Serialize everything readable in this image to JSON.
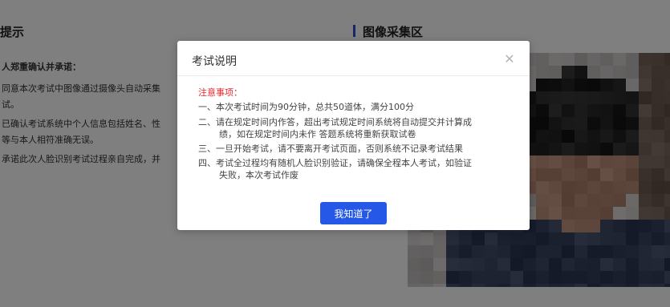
{
  "background": {
    "left_title": "提示",
    "right_title": "图像采集区",
    "notice_lines": [
      "人郑重确认并承诺：",
      "同意本次考试中图像通过摄像头自动采集",
      "试。",
      "已确认考试系统中个人信息包括姓名、性",
      "等与本人相符准确无误。",
      "承诺此次人脸识别考试过程亲自完成，并"
    ]
  },
  "dialog": {
    "title": "考试说明",
    "close_icon": "close-icon",
    "notes_heading": "注意事项：",
    "notes": [
      {
        "num": "一、",
        "lines": [
          "本次考试时间为90分钟，总共50道体，满分100分"
        ]
      },
      {
        "num": "二、",
        "lines": [
          "请在规定时间内作答，超出考试规定时间系统将自动提交并计算成",
          "绩，如在规定时间内未作 答题系统将重新获取试卷"
        ]
      },
      {
        "num": "三、",
        "lines": [
          "一旦开始考试，请不要离开考试页面，否则系统不记录考试结果"
        ]
      },
      {
        "num": "四、",
        "lines": [
          "考试全过程均有随机人脸识别验证，请确保全程本人考试，如验证",
          "失败，本次考试作废"
        ]
      }
    ],
    "ok_label": "我知道了"
  },
  "colors": {
    "accent": "#2558e6",
    "warning": "#e8262e"
  }
}
